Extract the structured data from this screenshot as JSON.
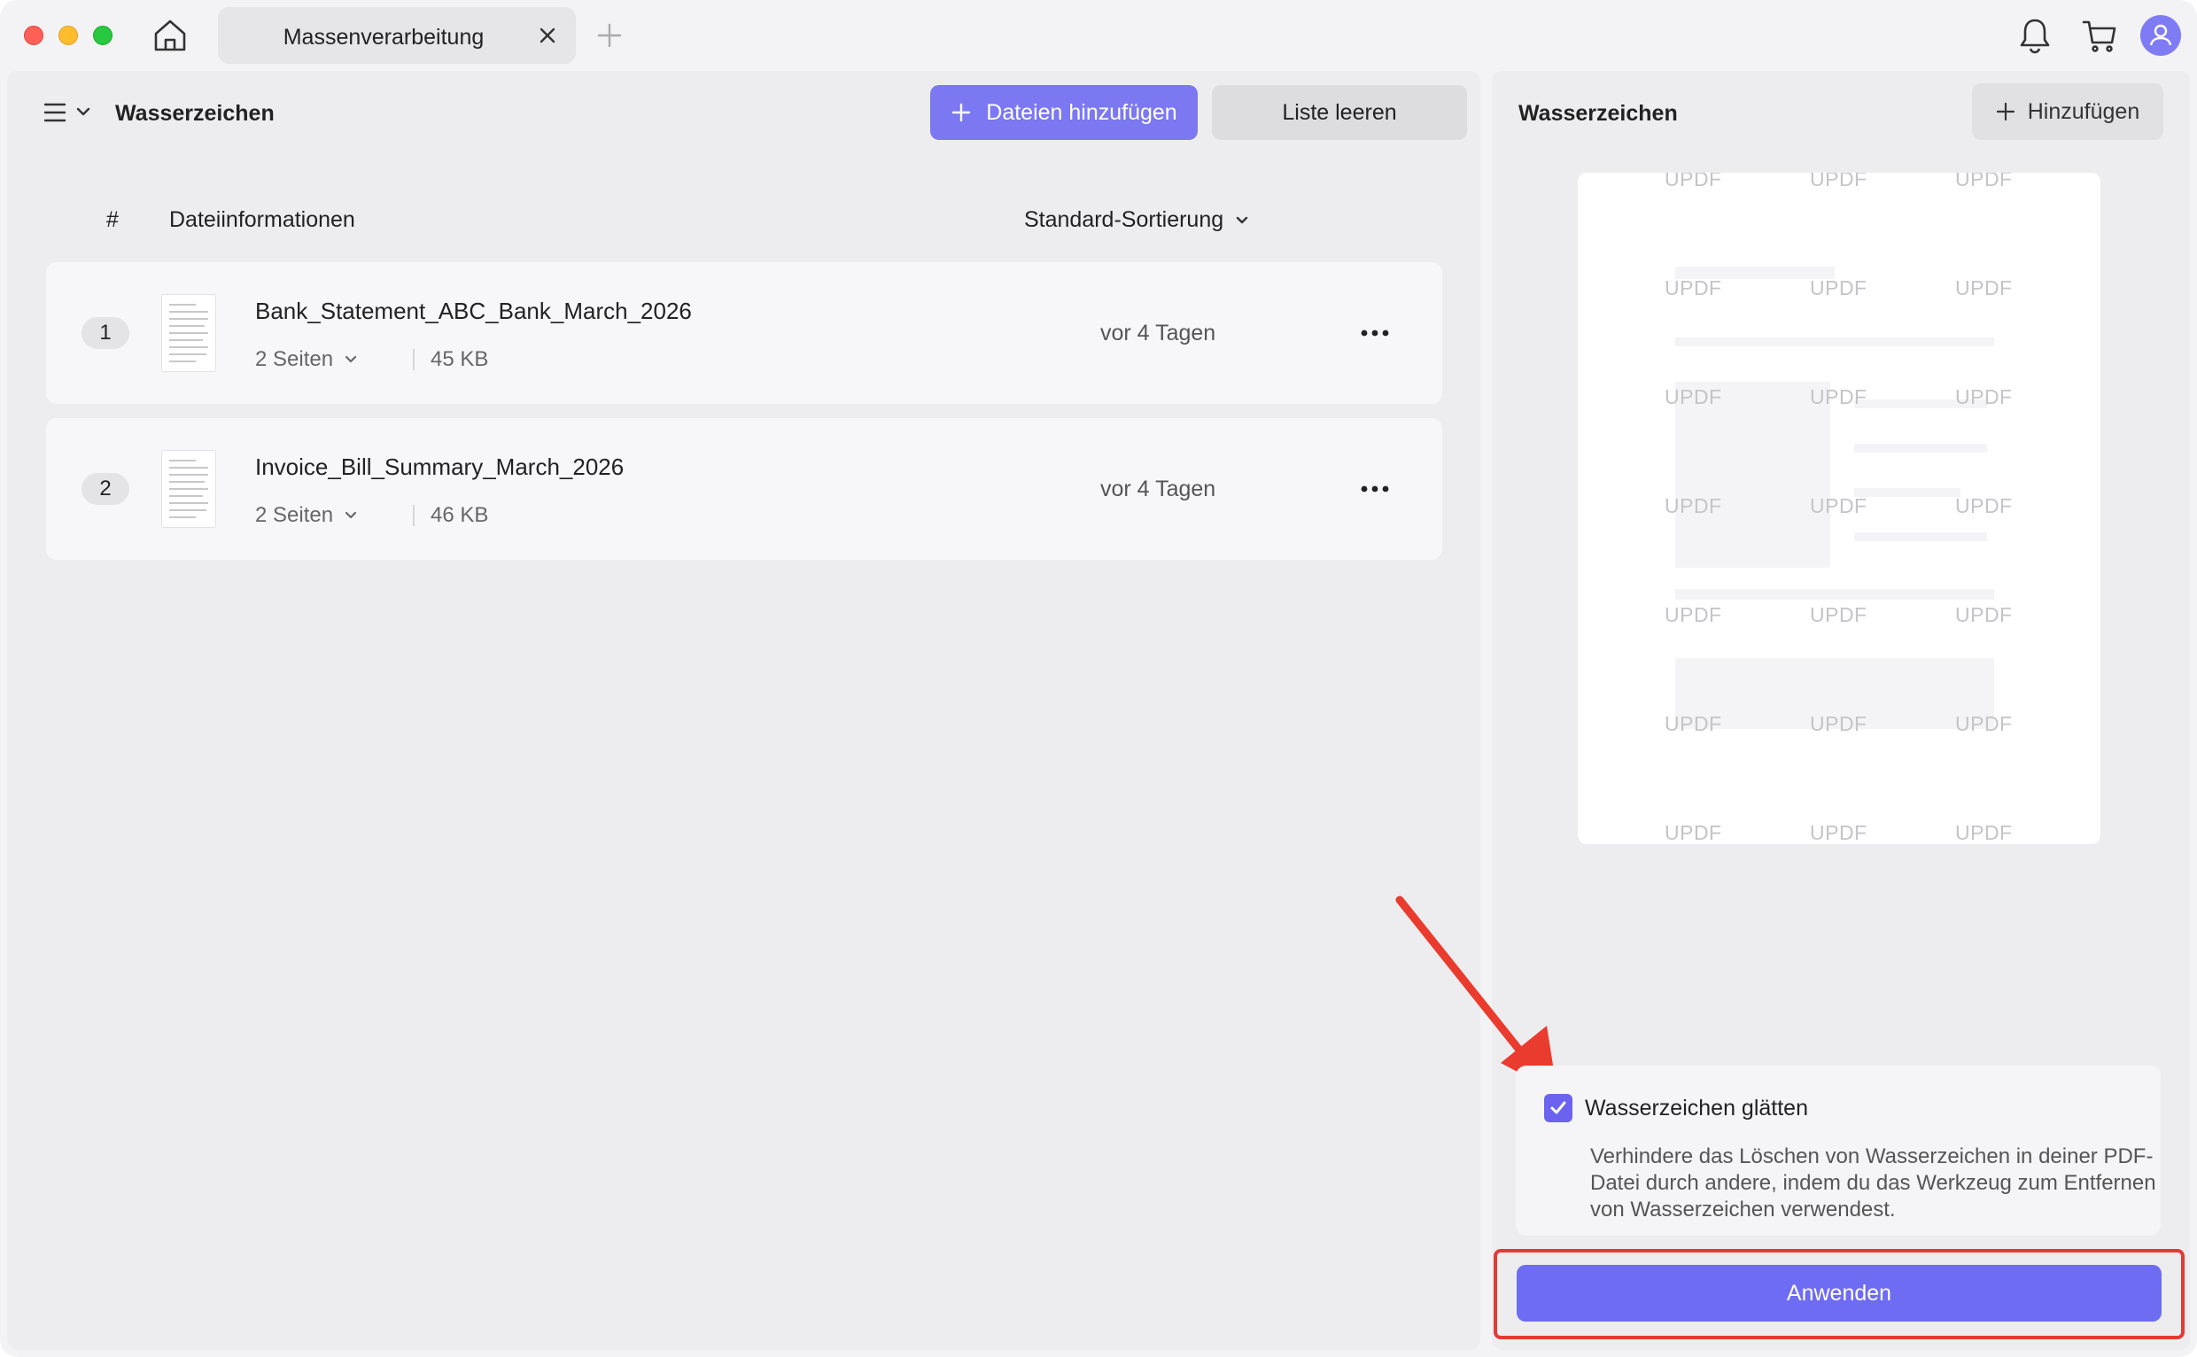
{
  "titlebar": {
    "tab_label": "Massenverarbeitung"
  },
  "toolbar": {
    "title": "Wasserzeichen",
    "add_files_label": "Dateien hinzufügen",
    "clear_list_label": "Liste leeren"
  },
  "file_list": {
    "col_number": "#",
    "col_info": "Dateiinformationen",
    "sort_label": "Standard-Sortierung",
    "files": [
      {
        "number": "1",
        "name": "Bank_Statement_ABC_Bank_March_2026",
        "pages": "2 Seiten",
        "size": "45 KB",
        "date": "vor 4 Tagen"
      },
      {
        "number": "2",
        "name": "Invoice_Bill_Summary_March_2026",
        "pages": "2 Seiten",
        "size": "46 KB",
        "date": "vor 4 Tagen"
      }
    ]
  },
  "right_panel": {
    "title": "Wasserzeichen",
    "add_label": "Hinzufügen",
    "watermark_text": "UPDF",
    "option_label": "Wasserzeichen glätten",
    "option_checked": true,
    "option_desc": "Verhindere das Löschen von Wasserzeichen in deiner PDF-Datei durch andere, indem du das Werkzeug zum Entfernen von Wasserzeichen verwendest.",
    "apply_label": "Anwenden"
  },
  "colors": {
    "accent": "#7b78f2",
    "highlight": "#e53935"
  }
}
